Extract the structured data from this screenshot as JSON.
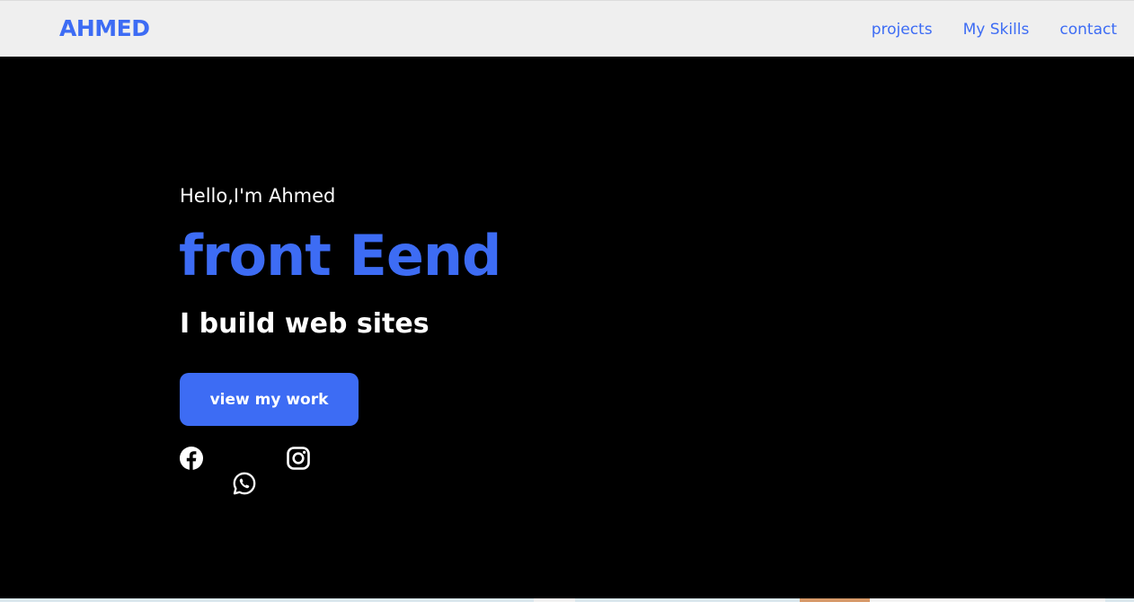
{
  "header": {
    "logo": "AHMED",
    "nav": [
      {
        "label": "projects"
      },
      {
        "label": "My Skills"
      },
      {
        "label": "contact"
      }
    ]
  },
  "hero": {
    "greeting": "Hello,I'm Ahmed",
    "role": "front Eend",
    "tagline": "I build web sites",
    "cta_label": "view my work",
    "social_icons": [
      "facebook-icon",
      "instagram-icon",
      "whatsapp-icon"
    ]
  },
  "colors": {
    "accent": "#3d6cf4",
    "header_bg": "#efefef",
    "hero_bg": "#000000",
    "text_light": "#ffffff"
  }
}
